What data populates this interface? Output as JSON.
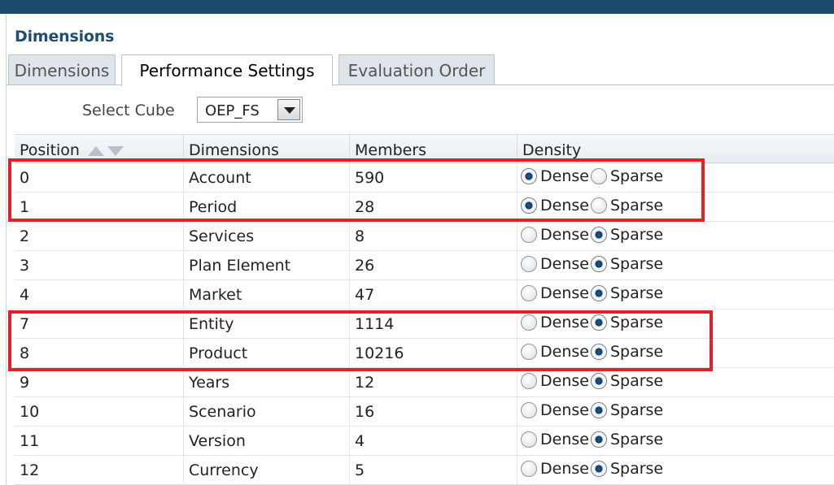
{
  "panel": {
    "title": "Dimensions"
  },
  "tabs": [
    {
      "label": "Dimensions"
    },
    {
      "label": "Performance Settings"
    },
    {
      "label": "Evaluation Order"
    }
  ],
  "cube": {
    "label": "Select Cube",
    "selected": "OEP_FS"
  },
  "table": {
    "headers": {
      "position": "Position",
      "dimensions": "Dimensions",
      "members": "Members",
      "density": "Density"
    },
    "dense_label": "Dense",
    "sparse_label": "Sparse",
    "rows": [
      {
        "position": "0",
        "dimension": "Account",
        "members": "590",
        "density": "Dense"
      },
      {
        "position": "1",
        "dimension": "Period",
        "members": "28",
        "density": "Dense"
      },
      {
        "position": "2",
        "dimension": "Services",
        "members": "8",
        "density": "Sparse"
      },
      {
        "position": "3",
        "dimension": "Plan Element",
        "members": "26",
        "density": "Sparse"
      },
      {
        "position": "4",
        "dimension": "Market",
        "members": "47",
        "density": "Sparse"
      },
      {
        "position": "7",
        "dimension": "Entity",
        "members": "1114",
        "density": "Sparse"
      },
      {
        "position": "8",
        "dimension": "Product",
        "members": "10216",
        "density": "Sparse"
      },
      {
        "position": "9",
        "dimension": "Years",
        "members": "12",
        "density": "Sparse"
      },
      {
        "position": "10",
        "dimension": "Scenario",
        "members": "16",
        "density": "Sparse"
      },
      {
        "position": "11",
        "dimension": "Version",
        "members": "4",
        "density": "Sparse"
      },
      {
        "position": "12",
        "dimension": "Currency",
        "members": "5",
        "density": "Sparse"
      }
    ]
  },
  "colors": {
    "highlight": "#e3202a",
    "title": "#1f4e70",
    "topbar": "#1b4a6b"
  }
}
